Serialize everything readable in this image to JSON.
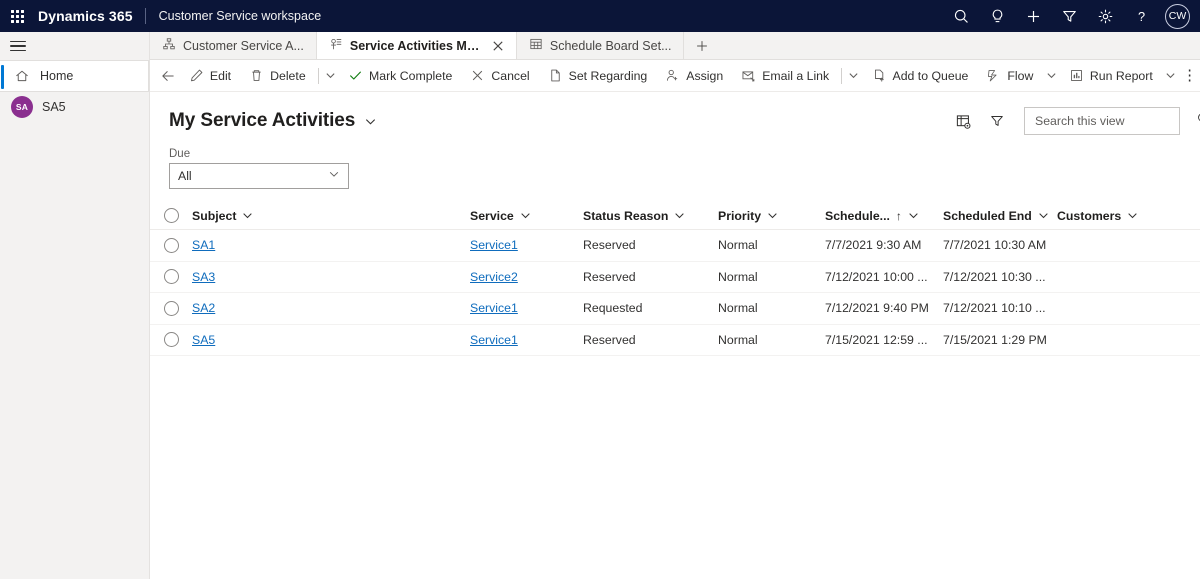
{
  "appbar": {
    "waffle_icon": "app-launcher-icon",
    "brand": "Dynamics 365",
    "app_name": "Customer Service workspace",
    "icons": [
      {
        "name": "search-icon",
        "label": "Search"
      },
      {
        "name": "lightbulb-icon",
        "label": "Assistant"
      },
      {
        "name": "plus-icon",
        "label": "New"
      },
      {
        "name": "filter-icon",
        "label": "Filter"
      },
      {
        "name": "gear-icon",
        "label": "Settings"
      },
      {
        "name": "help-icon",
        "label": "?"
      }
    ],
    "avatar_initials": "CW"
  },
  "rail": {
    "hamburger_icon": "hamburger-icon",
    "items": [
      {
        "label": "Home",
        "icon": "home-icon",
        "active": true
      },
      {
        "label": "SA5",
        "icon": "avatar",
        "avatar_initials": "SA",
        "active": false
      }
    ]
  },
  "tabs": {
    "items": [
      {
        "label": "Customer Service A...",
        "icon": "sitemap-icon",
        "active": false,
        "closable": false
      },
      {
        "label": "Service Activities My Ser...",
        "icon": "service-activity-icon",
        "active": true,
        "closable": true
      },
      {
        "label": "Schedule Board Set...",
        "icon": "calendar-grid-icon",
        "active": false,
        "closable": false
      }
    ],
    "new_tab_label": "+"
  },
  "commandbar": {
    "back_label": "Back",
    "items": [
      {
        "label": "Edit",
        "icon": "pencil-icon",
        "type": "button"
      },
      {
        "label": "Delete",
        "icon": "trash-icon",
        "type": "button"
      },
      {
        "label": "",
        "icon": "chevron-down-icon",
        "type": "chevron"
      },
      {
        "label": "Mark Complete",
        "icon": "check-icon",
        "type": "button"
      },
      {
        "label": "Cancel",
        "icon": "x-icon",
        "type": "button"
      },
      {
        "label": "Set Regarding",
        "icon": "document-icon",
        "type": "button"
      },
      {
        "label": "Assign",
        "icon": "person-icon",
        "type": "button"
      },
      {
        "label": "Email a Link",
        "icon": "email-link-icon",
        "type": "button"
      },
      {
        "label": "",
        "icon": "chevron-down-icon",
        "type": "chevron"
      },
      {
        "label": "Add to Queue",
        "icon": "add-queue-icon",
        "type": "button"
      },
      {
        "label": "Flow",
        "icon": "flow-icon",
        "type": "button"
      },
      {
        "label": "",
        "icon": "chevron-down-icon",
        "type": "chevron"
      },
      {
        "label": "Run Report",
        "icon": "report-icon",
        "type": "button"
      },
      {
        "label": "",
        "icon": "chevron-down-icon",
        "type": "chevron"
      }
    ],
    "overflow_label": "⋮"
  },
  "view": {
    "title": "My Service Activities",
    "title_chevron_icon": "chevron-down-icon",
    "edit_columns_icon": "edit-columns-icon",
    "filter_icon": "filter-icon",
    "search": {
      "placeholder": "Search this view",
      "value": "",
      "icon": "search-icon"
    }
  },
  "due_filter": {
    "label": "Due",
    "value": "All",
    "chevron_icon": "chevron-down-icon"
  },
  "grid": {
    "select_all_icon": "select-all-circle",
    "columns": [
      {
        "key": "subject",
        "label": "Subject",
        "sorted": false
      },
      {
        "key": "service",
        "label": "Service",
        "sorted": false
      },
      {
        "key": "status",
        "label": "Status Reason",
        "sorted": false
      },
      {
        "key": "priority",
        "label": "Priority",
        "sorted": false
      },
      {
        "key": "sstart",
        "label": "Schedule...",
        "sorted": true,
        "sort_direction": "asc",
        "sort_icon": "↑"
      },
      {
        "key": "send",
        "label": "Scheduled End",
        "sorted": false
      },
      {
        "key": "cust",
        "label": "Customers",
        "sorted": false
      }
    ],
    "rows": [
      {
        "subject": "SA1",
        "service": "Service1",
        "status": "Reserved",
        "priority": "Normal",
        "sstart": "7/7/2021 9:30 AM",
        "send": "7/7/2021 10:30 AM",
        "cust": ""
      },
      {
        "subject": "SA3",
        "service": "Service2",
        "status": "Reserved",
        "priority": "Normal",
        "sstart": "7/12/2021 10:00 ...",
        "send": "7/12/2021 10:30 ...",
        "cust": ""
      },
      {
        "subject": "SA2",
        "service": "Service1",
        "status": "Requested",
        "priority": "Normal",
        "sstart": "7/12/2021 9:40 PM",
        "send": "7/12/2021 10:10 ...",
        "cust": ""
      },
      {
        "subject": "SA5",
        "service": "Service1",
        "status": "Reserved",
        "priority": "Normal",
        "sstart": "7/15/2021 12:59 ...",
        "send": "7/15/2021 1:29 PM",
        "cust": ""
      }
    ]
  },
  "colors": {
    "appbar_bg": "#0b1538",
    "accent": "#0078d4",
    "link": "#0f6cbd",
    "avatar_purple": "#8a2f8f",
    "rail_bg": "#f3f2f1"
  }
}
